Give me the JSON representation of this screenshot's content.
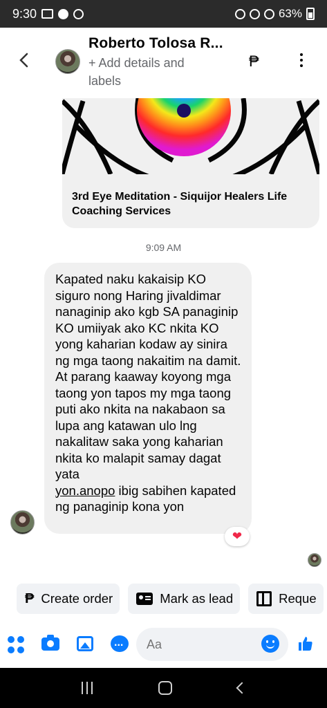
{
  "status_bar": {
    "time": "9:30",
    "battery": "63%"
  },
  "header": {
    "contact_name": "Roberto Tolosa R...",
    "subtitle": "+ Add details and labels",
    "peso_symbol": "₱"
  },
  "link_card": {
    "title": "3rd Eye Meditation - Siquijor Healers Life Coaching Services"
  },
  "timestamp": "9:09 AM",
  "message": {
    "text_main": "Kapated naku kakaisip KO siguro nong Haring jivaldimar nanaginip ako kgb SA panaginip KO umiiyak ako KC nkita KO yong kaharian kodaw ay sinira ng mga taong nakaitim na damit. At parang kaaway koyong mga taong yon tapos my mga taong puti ako nkita na nakabaon sa lupa ang katawan ulo lng nakalitaw saka yong kaharian nkita ko malapit samay dagat yata",
    "text_link": "yon.anopo",
    "text_end": " ibig sabihen kapated ng panaginip kona yon",
    "reaction": "❤"
  },
  "quick_actions": [
    {
      "label": "Create order",
      "icon": "peso-icon"
    },
    {
      "label": "Mark as lead",
      "icon": "contact-card-icon"
    },
    {
      "label": "Reque",
      "icon": "map-icon"
    }
  ],
  "composer": {
    "placeholder": "Aa"
  },
  "colors": {
    "accent": "#0a7cff",
    "bubble": "#f0f0f0",
    "status_bar": "#2b2b2b",
    "heart": "#f02849"
  }
}
